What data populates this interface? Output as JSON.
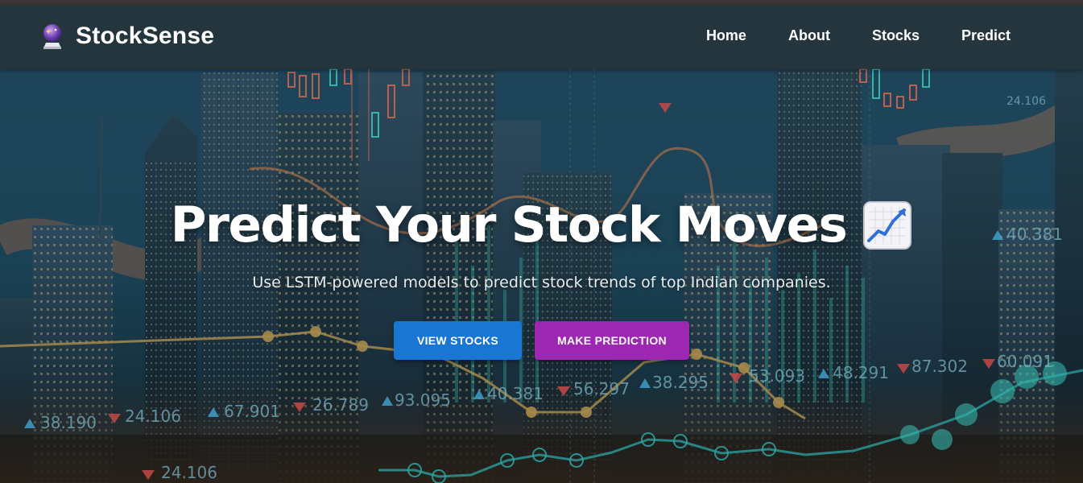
{
  "navbar": {
    "brand": "StockSense",
    "brand_icon": "crystal-ball-icon",
    "links": [
      "Home",
      "About",
      "Stocks",
      "Predict"
    ]
  },
  "hero": {
    "title": "Predict Your Stock Moves",
    "title_icon": "chart-increasing-icon",
    "subtitle": "Use LSTM-powered models to predict stock trends of top Indian companies.",
    "buttons": {
      "view_stocks": "VIEW STOCKS",
      "make_prediction": "MAKE PREDICTION"
    },
    "ticker_labels": [
      "38.190",
      "24.106",
      "67.901",
      "26.789",
      "93.095",
      "40.381",
      "56.297",
      "38.295",
      "53.093",
      "48.291",
      "87.302",
      "60.091",
      "40.381",
      "24.106",
      "24.106"
    ]
  },
  "colors": {
    "primary": "#1976d2",
    "secondary": "#9c27b0",
    "navbar": "#263238",
    "up": "#4fc3f7",
    "down": "#ef5350"
  }
}
